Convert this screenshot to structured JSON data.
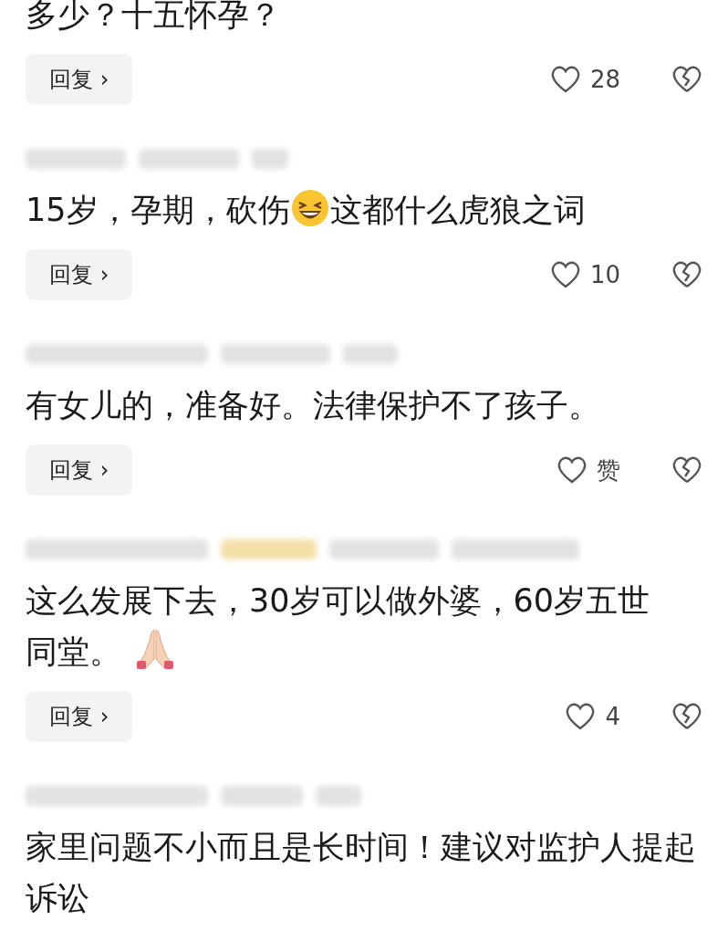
{
  "comments": [
    {
      "header": false,
      "badge": false,
      "segments": [
        {
          "kind": "text",
          "text": "多少？十五怀孕？"
        }
      ],
      "reply": "回复",
      "reply_arrow": "›",
      "likes": "28"
    },
    {
      "header": true,
      "badge": false,
      "segments": [
        {
          "kind": "text",
          "text": "15岁，孕期，砍伤"
        },
        {
          "kind": "laugh"
        },
        {
          "kind": "text",
          "text": "这都什么虎狼之词"
        }
      ],
      "reply": "回复",
      "reply_arrow": "›",
      "likes": "10"
    },
    {
      "header": true,
      "badge": false,
      "segments": [
        {
          "kind": "text",
          "text": "有女儿的，准备好。法律保护不了孩子。"
        }
      ],
      "reply": "回复",
      "reply_arrow": "›",
      "likes": "赞"
    },
    {
      "header": true,
      "badge": true,
      "segments": [
        {
          "kind": "text",
          "text": "这么发展下去，30岁可以做外婆，60岁五世"
        },
        {
          "kind": "text",
          "text": "同堂。"
        },
        {
          "kind": "pray"
        }
      ],
      "reply": "回复",
      "reply_arrow": "›",
      "likes": "4"
    },
    {
      "header": true,
      "badge": false,
      "segments": [
        {
          "kind": "text",
          "text": "家里问题不小而且是长时间！建议对监护人提起诉讼"
        }
      ]
    }
  ]
}
